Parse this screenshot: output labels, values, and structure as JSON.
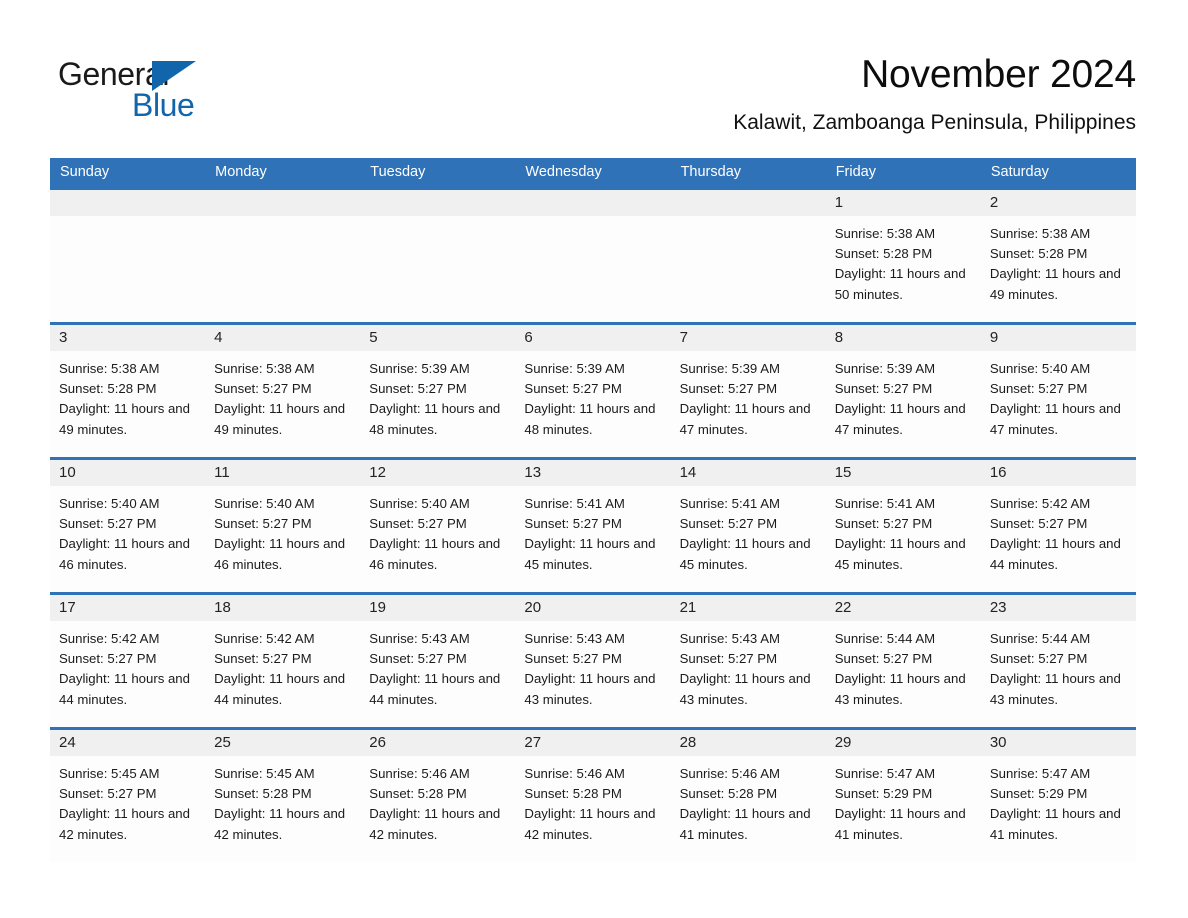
{
  "brand": {
    "name_part1": "General",
    "name_part2": "Blue",
    "triangle_icon": "triangle-icon",
    "accent_color": "#1166ab"
  },
  "header": {
    "title": "November 2024",
    "subtitle": "Kalawit, Zamboanga Peninsula, Philippines"
  },
  "calendar": {
    "header_bg_color": "#2f72b8",
    "day_band_color": "#f0f0f0",
    "weekdays": [
      "Sunday",
      "Monday",
      "Tuesday",
      "Wednesday",
      "Thursday",
      "Friday",
      "Saturday"
    ],
    "weeks": [
      [
        {
          "day": "",
          "sunrise": "",
          "sunset": "",
          "daylight": ""
        },
        {
          "day": "",
          "sunrise": "",
          "sunset": "",
          "daylight": ""
        },
        {
          "day": "",
          "sunrise": "",
          "sunset": "",
          "daylight": ""
        },
        {
          "day": "",
          "sunrise": "",
          "sunset": "",
          "daylight": ""
        },
        {
          "day": "",
          "sunrise": "",
          "sunset": "",
          "daylight": ""
        },
        {
          "day": "1",
          "sunrise": "Sunrise: 5:38 AM",
          "sunset": "Sunset: 5:28 PM",
          "daylight": "Daylight: 11 hours and 50 minutes."
        },
        {
          "day": "2",
          "sunrise": "Sunrise: 5:38 AM",
          "sunset": "Sunset: 5:28 PM",
          "daylight": "Daylight: 11 hours and 49 minutes."
        }
      ],
      [
        {
          "day": "3",
          "sunrise": "Sunrise: 5:38 AM",
          "sunset": "Sunset: 5:28 PM",
          "daylight": "Daylight: 11 hours and 49 minutes."
        },
        {
          "day": "4",
          "sunrise": "Sunrise: 5:38 AM",
          "sunset": "Sunset: 5:27 PM",
          "daylight": "Daylight: 11 hours and 49 minutes."
        },
        {
          "day": "5",
          "sunrise": "Sunrise: 5:39 AM",
          "sunset": "Sunset: 5:27 PM",
          "daylight": "Daylight: 11 hours and 48 minutes."
        },
        {
          "day": "6",
          "sunrise": "Sunrise: 5:39 AM",
          "sunset": "Sunset: 5:27 PM",
          "daylight": "Daylight: 11 hours and 48 minutes."
        },
        {
          "day": "7",
          "sunrise": "Sunrise: 5:39 AM",
          "sunset": "Sunset: 5:27 PM",
          "daylight": "Daylight: 11 hours and 47 minutes."
        },
        {
          "day": "8",
          "sunrise": "Sunrise: 5:39 AM",
          "sunset": "Sunset: 5:27 PM",
          "daylight": "Daylight: 11 hours and 47 minutes."
        },
        {
          "day": "9",
          "sunrise": "Sunrise: 5:40 AM",
          "sunset": "Sunset: 5:27 PM",
          "daylight": "Daylight: 11 hours and 47 minutes."
        }
      ],
      [
        {
          "day": "10",
          "sunrise": "Sunrise: 5:40 AM",
          "sunset": "Sunset: 5:27 PM",
          "daylight": "Daylight: 11 hours and 46 minutes."
        },
        {
          "day": "11",
          "sunrise": "Sunrise: 5:40 AM",
          "sunset": "Sunset: 5:27 PM",
          "daylight": "Daylight: 11 hours and 46 minutes."
        },
        {
          "day": "12",
          "sunrise": "Sunrise: 5:40 AM",
          "sunset": "Sunset: 5:27 PM",
          "daylight": "Daylight: 11 hours and 46 minutes."
        },
        {
          "day": "13",
          "sunrise": "Sunrise: 5:41 AM",
          "sunset": "Sunset: 5:27 PM",
          "daylight": "Daylight: 11 hours and 45 minutes."
        },
        {
          "day": "14",
          "sunrise": "Sunrise: 5:41 AM",
          "sunset": "Sunset: 5:27 PM",
          "daylight": "Daylight: 11 hours and 45 minutes."
        },
        {
          "day": "15",
          "sunrise": "Sunrise: 5:41 AM",
          "sunset": "Sunset: 5:27 PM",
          "daylight": "Daylight: 11 hours and 45 minutes."
        },
        {
          "day": "16",
          "sunrise": "Sunrise: 5:42 AM",
          "sunset": "Sunset: 5:27 PM",
          "daylight": "Daylight: 11 hours and 44 minutes."
        }
      ],
      [
        {
          "day": "17",
          "sunrise": "Sunrise: 5:42 AM",
          "sunset": "Sunset: 5:27 PM",
          "daylight": "Daylight: 11 hours and 44 minutes."
        },
        {
          "day": "18",
          "sunrise": "Sunrise: 5:42 AM",
          "sunset": "Sunset: 5:27 PM",
          "daylight": "Daylight: 11 hours and 44 minutes."
        },
        {
          "day": "19",
          "sunrise": "Sunrise: 5:43 AM",
          "sunset": "Sunset: 5:27 PM",
          "daylight": "Daylight: 11 hours and 44 minutes."
        },
        {
          "day": "20",
          "sunrise": "Sunrise: 5:43 AM",
          "sunset": "Sunset: 5:27 PM",
          "daylight": "Daylight: 11 hours and 43 minutes."
        },
        {
          "day": "21",
          "sunrise": "Sunrise: 5:43 AM",
          "sunset": "Sunset: 5:27 PM",
          "daylight": "Daylight: 11 hours and 43 minutes."
        },
        {
          "day": "22",
          "sunrise": "Sunrise: 5:44 AM",
          "sunset": "Sunset: 5:27 PM",
          "daylight": "Daylight: 11 hours and 43 minutes."
        },
        {
          "day": "23",
          "sunrise": "Sunrise: 5:44 AM",
          "sunset": "Sunset: 5:27 PM",
          "daylight": "Daylight: 11 hours and 43 minutes."
        }
      ],
      [
        {
          "day": "24",
          "sunrise": "Sunrise: 5:45 AM",
          "sunset": "Sunset: 5:27 PM",
          "daylight": "Daylight: 11 hours and 42 minutes."
        },
        {
          "day": "25",
          "sunrise": "Sunrise: 5:45 AM",
          "sunset": "Sunset: 5:28 PM",
          "daylight": "Daylight: 11 hours and 42 minutes."
        },
        {
          "day": "26",
          "sunrise": "Sunrise: 5:46 AM",
          "sunset": "Sunset: 5:28 PM",
          "daylight": "Daylight: 11 hours and 42 minutes."
        },
        {
          "day": "27",
          "sunrise": "Sunrise: 5:46 AM",
          "sunset": "Sunset: 5:28 PM",
          "daylight": "Daylight: 11 hours and 42 minutes."
        },
        {
          "day": "28",
          "sunrise": "Sunrise: 5:46 AM",
          "sunset": "Sunset: 5:28 PM",
          "daylight": "Daylight: 11 hours and 41 minutes."
        },
        {
          "day": "29",
          "sunrise": "Sunrise: 5:47 AM",
          "sunset": "Sunset: 5:29 PM",
          "daylight": "Daylight: 11 hours and 41 minutes."
        },
        {
          "day": "30",
          "sunrise": "Sunrise: 5:47 AM",
          "sunset": "Sunset: 5:29 PM",
          "daylight": "Daylight: 11 hours and 41 minutes."
        }
      ]
    ]
  }
}
